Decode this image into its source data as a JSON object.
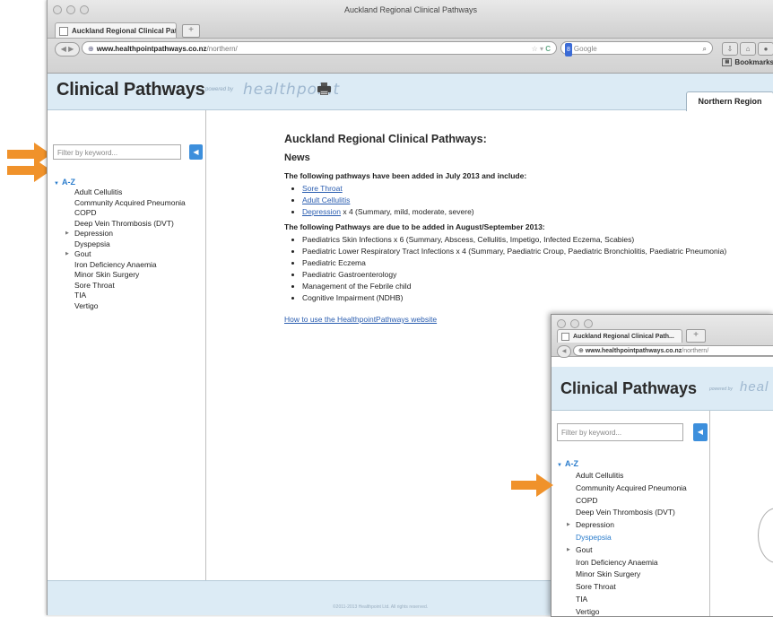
{
  "window": {
    "title": "Auckland Regional Clinical Pathways",
    "tab_label": "Auckland Regional Clinical Path...",
    "new_tab": "+",
    "url_host": "www.healthpointpathways.co.nz",
    "url_path": "/northern/",
    "search_engine": "Google",
    "bookmarks_label": "Bookmarks"
  },
  "header": {
    "brand": "Clinical Pathways",
    "powered_by": "powered by",
    "healthpoint": "healthpoint",
    "region_tab": "Northern Region"
  },
  "sidebar": {
    "filter_placeholder": "Filter by keyword...",
    "az_label": "A-Z",
    "items": [
      {
        "label": "Adult Cellulitis",
        "expandable": false
      },
      {
        "label": "Community Acquired Pneumonia",
        "expandable": false
      },
      {
        "label": "COPD",
        "expandable": false
      },
      {
        "label": "Deep Vein Thrombosis (DVT)",
        "expandable": false
      },
      {
        "label": "Depression",
        "expandable": true
      },
      {
        "label": "Dyspepsia",
        "expandable": false
      },
      {
        "label": "Gout",
        "expandable": true
      },
      {
        "label": "Iron Deficiency Anaemia",
        "expandable": false
      },
      {
        "label": "Minor Skin Surgery",
        "expandable": false
      },
      {
        "label": "Sore Throat",
        "expandable": false
      },
      {
        "label": "TIA",
        "expandable": false
      },
      {
        "label": "Vertigo",
        "expandable": false
      }
    ]
  },
  "content": {
    "title": "Auckland Regional Clinical Pathways:",
    "subtitle": "News",
    "added_intro": "The following pathways have been added in July 2013 and include:",
    "added_items": [
      {
        "link": "Sore Throat",
        "suffix": ""
      },
      {
        "link": "Adult Cellulitis",
        "suffix": ""
      },
      {
        "link": "Depression",
        "suffix": " x 4 (Summary, mild, moderate, severe)"
      }
    ],
    "upcoming_intro": "The following Pathways are due to be added in August/September 2013:",
    "upcoming_items": [
      "Paediatrics Skin Infections x 6 (Summary, Abscess, Cellulitis, Impetigo, Infected Eczema, Scabies)",
      "Paediatric Lower Respiratory Tract Infections x 4 (Summary, Paediatric Croup, Paediatric Bronchiolitis, Paediatric Pneumonia)",
      "Paediatric Eczema",
      "Paediatric Gastroenterology",
      "Management of the Febrile child",
      "Cognitive Impairment (NDHB)"
    ],
    "howto_link": "How to use the HealthpointPathways website"
  },
  "footer": {
    "copyright": "©2011-2013 Healthpoint Ltd. All rights reserved."
  },
  "inset": {
    "tab_label": "Auckland Regional Clinical Path...",
    "url_host": "www.healthpointpathways.co.nz",
    "url_path": "/northern/",
    "brand": "Clinical Pathways",
    "powered_by": "powered by",
    "healthpoint": "heal",
    "filter_placeholder": "Filter by keyword...",
    "az_label": "A-Z",
    "items": [
      {
        "label": "Adult Cellulitis",
        "expandable": false,
        "highlight": false
      },
      {
        "label": "Community Acquired Pneumonia",
        "expandable": false,
        "highlight": false
      },
      {
        "label": "COPD",
        "expandable": false,
        "highlight": false
      },
      {
        "label": "Deep Vein Thrombosis (DVT)",
        "expandable": false,
        "highlight": false
      },
      {
        "label": "Depression",
        "expandable": true,
        "highlight": false
      },
      {
        "label": "Dyspepsia",
        "expandable": false,
        "highlight": true
      },
      {
        "label": "Gout",
        "expandable": true,
        "highlight": false
      },
      {
        "label": "Iron Deficiency Anaemia",
        "expandable": false,
        "highlight": false
      },
      {
        "label": "Minor Skin Surgery",
        "expandable": false,
        "highlight": false
      },
      {
        "label": "Sore Throat",
        "expandable": false,
        "highlight": false
      },
      {
        "label": "TIA",
        "expandable": false,
        "highlight": false
      },
      {
        "label": "Vertigo",
        "expandable": false,
        "highlight": false
      }
    ]
  },
  "colors": {
    "arrow": "#f0922b",
    "accent": "#2a7ccc",
    "header_bg": "#dcebf5"
  },
  "icons": [
    "window-controls-icon",
    "globe-icon",
    "printer-icon",
    "search-icon",
    "filter-arrow-icon",
    "arrow-annotation-icon"
  ]
}
